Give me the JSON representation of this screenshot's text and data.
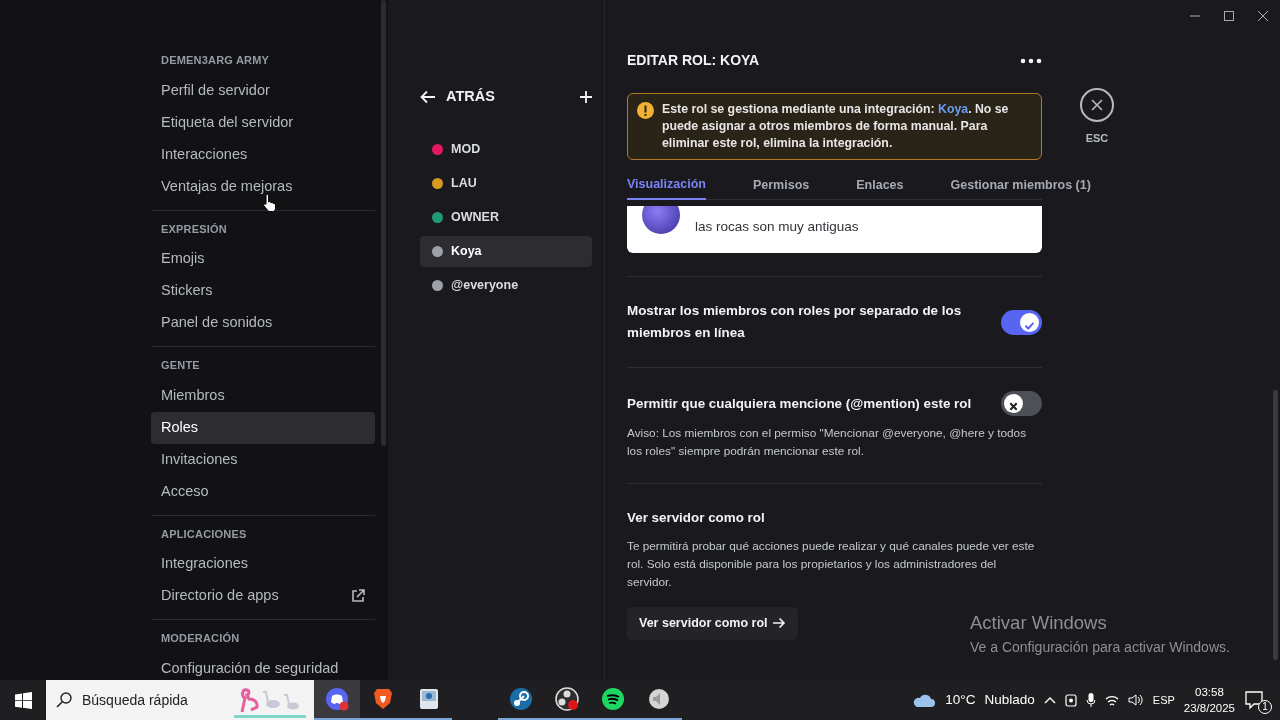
{
  "sidebar": {
    "sections": [
      {
        "heading": "DEMEN3ARG ARMY",
        "items": [
          {
            "label": "Perfil de servidor",
            "selected": false,
            "external": false
          },
          {
            "label": "Etiqueta del servidor",
            "selected": false,
            "external": false
          },
          {
            "label": "Interacciones",
            "selected": false,
            "external": false
          },
          {
            "label": "Ventajas de mejoras",
            "selected": false,
            "external": false
          }
        ]
      },
      {
        "heading": "EXPRESIÓN",
        "items": [
          {
            "label": "Emojis",
            "selected": false,
            "external": false
          },
          {
            "label": "Stickers",
            "selected": false,
            "external": false
          },
          {
            "label": "Panel de sonidos",
            "selected": false,
            "external": false
          }
        ]
      },
      {
        "heading": "GENTE",
        "items": [
          {
            "label": "Miembros",
            "selected": false,
            "external": false
          },
          {
            "label": "Roles",
            "selected": true,
            "external": false
          },
          {
            "label": "Invitaciones",
            "selected": false,
            "external": false
          },
          {
            "label": "Acceso",
            "selected": false,
            "external": false
          }
        ]
      },
      {
        "heading": "APLICACIONES",
        "items": [
          {
            "label": "Integraciones",
            "selected": false,
            "external": false
          },
          {
            "label": "Directorio de apps",
            "selected": false,
            "external": true
          }
        ]
      },
      {
        "heading": "MODERACIÓN",
        "items": [
          {
            "label": "Configuración de seguridad",
            "selected": false,
            "external": false
          }
        ]
      }
    ]
  },
  "roles_panel": {
    "back_label": "ATRÁS",
    "roles": [
      {
        "name": "MOD",
        "color": "#e3175f",
        "selected": false
      },
      {
        "name": "LAU",
        "color": "#d69a1e",
        "selected": false
      },
      {
        "name": "OWNER",
        "color": "#1f9b74",
        "selected": false
      },
      {
        "name": "Koya",
        "color": "#9ca0a8",
        "selected": true
      },
      {
        "name": "@everyone",
        "color": "#9ca0a8",
        "selected": false
      }
    ]
  },
  "editor": {
    "title": "EDITAR ROL: KOYA",
    "notice": {
      "before": "Este rol se gestiona mediante una integración: ",
      "link": "Koya",
      "after": ". No se puede asignar a otros miembros de forma manual. Para eliminar este rol, elimina la integración."
    },
    "tabs": [
      {
        "label": "Visualización",
        "selected": true
      },
      {
        "label": "Permisos",
        "selected": false
      },
      {
        "label": "Enlaces",
        "selected": false
      },
      {
        "label": "Gestionar miembros (1)",
        "selected": false
      }
    ],
    "preview": {
      "message": "las rocas son muy antiguas"
    },
    "settings": [
      {
        "kind": "toggle",
        "title": "Mostrar los miembros con roles por separado de los miembros en línea",
        "on": true
      },
      {
        "kind": "toggle",
        "title": "Permitir que cualquiera mencione (@mention) este rol",
        "on": false,
        "note": "Aviso: Los miembros con el permiso \"Mencionar @everyone, @here y todos los roles\" siempre podrán mencionar este rol."
      },
      {
        "kind": "action",
        "title": "Ver servidor como rol",
        "description": "Te permitirá probar qué acciones puede realizar y qué canales puede ver este rol. Solo está disponible para los propietarios y los administradores del servidor.",
        "button": "Ver servidor como rol"
      }
    ]
  },
  "close": {
    "label": "ESC"
  },
  "activation_notice": {
    "title": "Activar Windows",
    "subtitle": "Ve a Configuración para activar Windows."
  },
  "taskbar": {
    "search_placeholder": "Búsqueda rápida",
    "apps": [
      {
        "kind": "chat",
        "selected": true
      },
      {
        "kind": "browser",
        "selected": false
      },
      {
        "kind": "utility",
        "selected": false
      },
      {
        "kind": "game-store",
        "selected": false
      },
      {
        "kind": "recorder",
        "selected": false
      },
      {
        "kind": "music",
        "selected": false
      },
      {
        "kind": "speaker",
        "selected": false
      }
    ],
    "temperature": "10°C",
    "condition": "Nublado",
    "language": "ESP",
    "time": "03:58",
    "date": "23/8/2025",
    "notifications": "1"
  }
}
